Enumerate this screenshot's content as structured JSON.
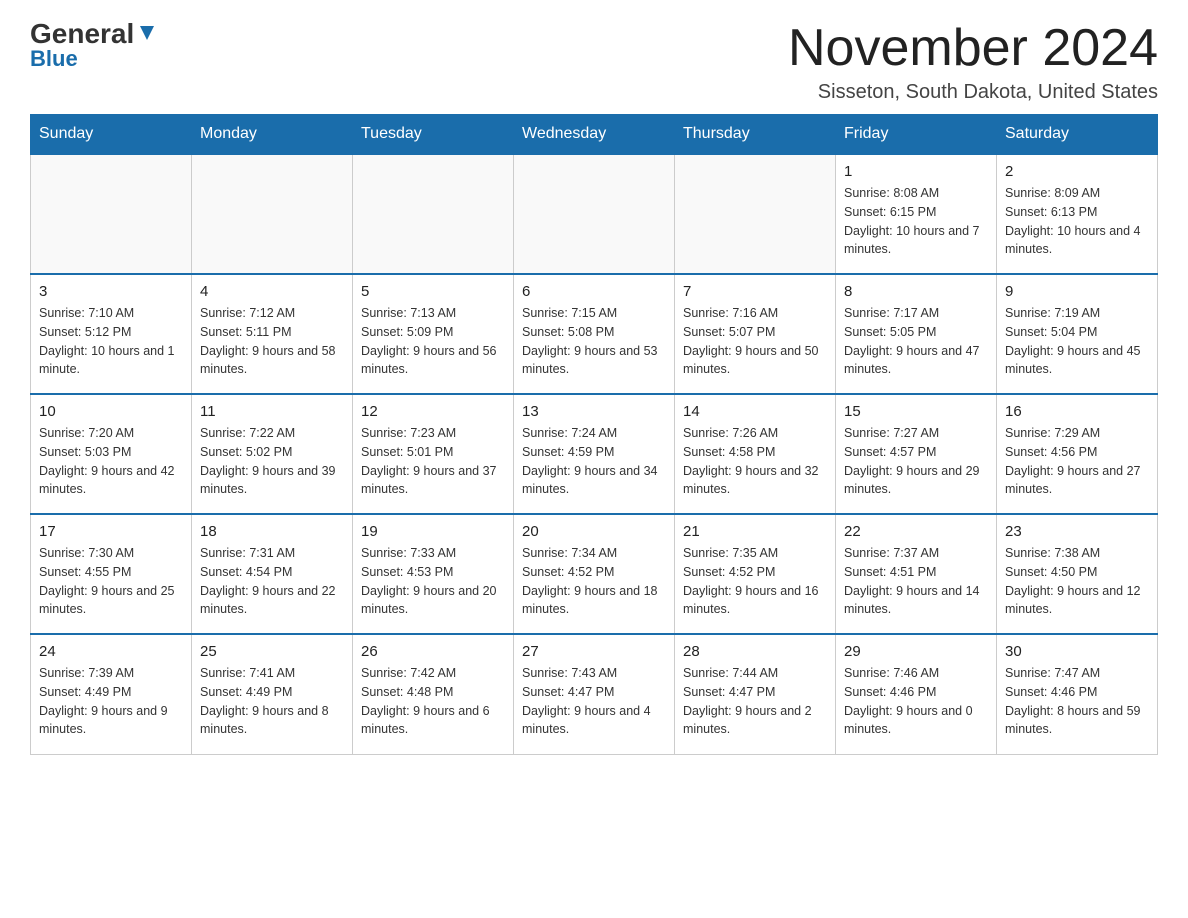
{
  "header": {
    "logo_general": "General",
    "logo_blue": "Blue",
    "month_title": "November 2024",
    "location": "Sisseton, South Dakota, United States"
  },
  "days_of_week": [
    "Sunday",
    "Monday",
    "Tuesday",
    "Wednesday",
    "Thursday",
    "Friday",
    "Saturday"
  ],
  "weeks": [
    [
      {
        "day": "",
        "info": ""
      },
      {
        "day": "",
        "info": ""
      },
      {
        "day": "",
        "info": ""
      },
      {
        "day": "",
        "info": ""
      },
      {
        "day": "",
        "info": ""
      },
      {
        "day": "1",
        "info": "Sunrise: 8:08 AM\nSunset: 6:15 PM\nDaylight: 10 hours and 7 minutes."
      },
      {
        "day": "2",
        "info": "Sunrise: 8:09 AM\nSunset: 6:13 PM\nDaylight: 10 hours and 4 minutes."
      }
    ],
    [
      {
        "day": "3",
        "info": "Sunrise: 7:10 AM\nSunset: 5:12 PM\nDaylight: 10 hours and 1 minute."
      },
      {
        "day": "4",
        "info": "Sunrise: 7:12 AM\nSunset: 5:11 PM\nDaylight: 9 hours and 58 minutes."
      },
      {
        "day": "5",
        "info": "Sunrise: 7:13 AM\nSunset: 5:09 PM\nDaylight: 9 hours and 56 minutes."
      },
      {
        "day": "6",
        "info": "Sunrise: 7:15 AM\nSunset: 5:08 PM\nDaylight: 9 hours and 53 minutes."
      },
      {
        "day": "7",
        "info": "Sunrise: 7:16 AM\nSunset: 5:07 PM\nDaylight: 9 hours and 50 minutes."
      },
      {
        "day": "8",
        "info": "Sunrise: 7:17 AM\nSunset: 5:05 PM\nDaylight: 9 hours and 47 minutes."
      },
      {
        "day": "9",
        "info": "Sunrise: 7:19 AM\nSunset: 5:04 PM\nDaylight: 9 hours and 45 minutes."
      }
    ],
    [
      {
        "day": "10",
        "info": "Sunrise: 7:20 AM\nSunset: 5:03 PM\nDaylight: 9 hours and 42 minutes."
      },
      {
        "day": "11",
        "info": "Sunrise: 7:22 AM\nSunset: 5:02 PM\nDaylight: 9 hours and 39 minutes."
      },
      {
        "day": "12",
        "info": "Sunrise: 7:23 AM\nSunset: 5:01 PM\nDaylight: 9 hours and 37 minutes."
      },
      {
        "day": "13",
        "info": "Sunrise: 7:24 AM\nSunset: 4:59 PM\nDaylight: 9 hours and 34 minutes."
      },
      {
        "day": "14",
        "info": "Sunrise: 7:26 AM\nSunset: 4:58 PM\nDaylight: 9 hours and 32 minutes."
      },
      {
        "day": "15",
        "info": "Sunrise: 7:27 AM\nSunset: 4:57 PM\nDaylight: 9 hours and 29 minutes."
      },
      {
        "day": "16",
        "info": "Sunrise: 7:29 AM\nSunset: 4:56 PM\nDaylight: 9 hours and 27 minutes."
      }
    ],
    [
      {
        "day": "17",
        "info": "Sunrise: 7:30 AM\nSunset: 4:55 PM\nDaylight: 9 hours and 25 minutes."
      },
      {
        "day": "18",
        "info": "Sunrise: 7:31 AM\nSunset: 4:54 PM\nDaylight: 9 hours and 22 minutes."
      },
      {
        "day": "19",
        "info": "Sunrise: 7:33 AM\nSunset: 4:53 PM\nDaylight: 9 hours and 20 minutes."
      },
      {
        "day": "20",
        "info": "Sunrise: 7:34 AM\nSunset: 4:52 PM\nDaylight: 9 hours and 18 minutes."
      },
      {
        "day": "21",
        "info": "Sunrise: 7:35 AM\nSunset: 4:52 PM\nDaylight: 9 hours and 16 minutes."
      },
      {
        "day": "22",
        "info": "Sunrise: 7:37 AM\nSunset: 4:51 PM\nDaylight: 9 hours and 14 minutes."
      },
      {
        "day": "23",
        "info": "Sunrise: 7:38 AM\nSunset: 4:50 PM\nDaylight: 9 hours and 12 minutes."
      }
    ],
    [
      {
        "day": "24",
        "info": "Sunrise: 7:39 AM\nSunset: 4:49 PM\nDaylight: 9 hours and 9 minutes."
      },
      {
        "day": "25",
        "info": "Sunrise: 7:41 AM\nSunset: 4:49 PM\nDaylight: 9 hours and 8 minutes."
      },
      {
        "day": "26",
        "info": "Sunrise: 7:42 AM\nSunset: 4:48 PM\nDaylight: 9 hours and 6 minutes."
      },
      {
        "day": "27",
        "info": "Sunrise: 7:43 AM\nSunset: 4:47 PM\nDaylight: 9 hours and 4 minutes."
      },
      {
        "day": "28",
        "info": "Sunrise: 7:44 AM\nSunset: 4:47 PM\nDaylight: 9 hours and 2 minutes."
      },
      {
        "day": "29",
        "info": "Sunrise: 7:46 AM\nSunset: 4:46 PM\nDaylight: 9 hours and 0 minutes."
      },
      {
        "day": "30",
        "info": "Sunrise: 7:47 AM\nSunset: 4:46 PM\nDaylight: 8 hours and 59 minutes."
      }
    ]
  ]
}
